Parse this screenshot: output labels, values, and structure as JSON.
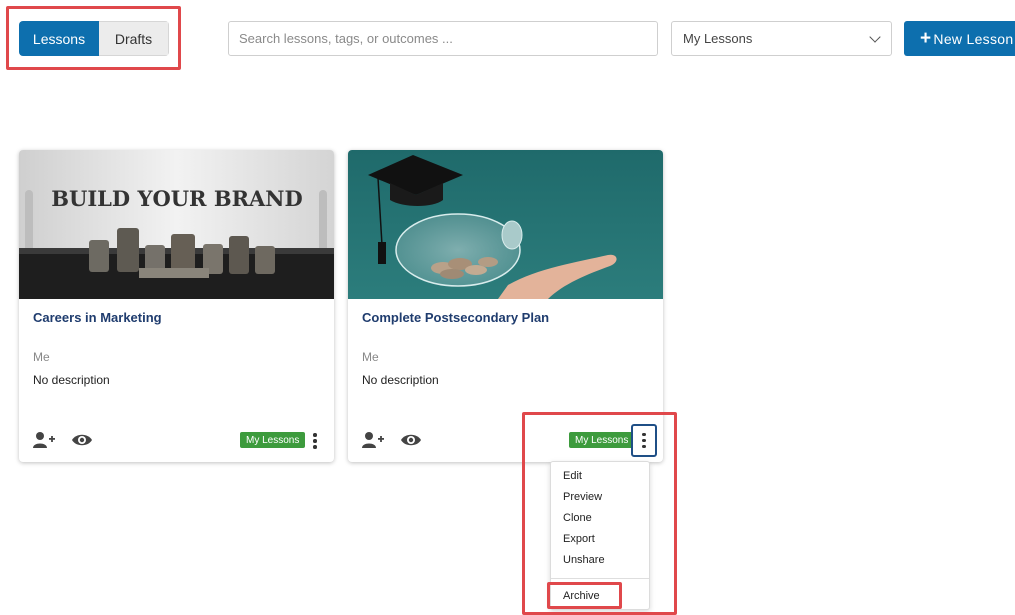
{
  "toolbar": {
    "tabs": [
      {
        "label": "Lessons",
        "active": true
      },
      {
        "label": "Drafts",
        "active": false
      }
    ],
    "search_placeholder": "Search lessons, tags, or outcomes ...",
    "filter_value": "My Lessons",
    "new_button": {
      "icon": "+",
      "label": "New Lesson"
    }
  },
  "cards": [
    {
      "image_text": "BUILD YOUR BRAND",
      "title": "Careers in Marketing",
      "author": "Me",
      "description": "No description",
      "badge": "My Lessons"
    },
    {
      "title": "Complete Postsecondary Plan",
      "author": "Me",
      "description": "No description",
      "badge": "My Lessons"
    }
  ],
  "menu": {
    "items": [
      "Edit",
      "Preview",
      "Clone",
      "Export",
      "Unshare"
    ],
    "archive": "Archive"
  },
  "colors": {
    "primary": "#0d6fae",
    "badge": "#3d9b3d",
    "highlight": "#e0484b",
    "title": "#1f3c6e"
  }
}
